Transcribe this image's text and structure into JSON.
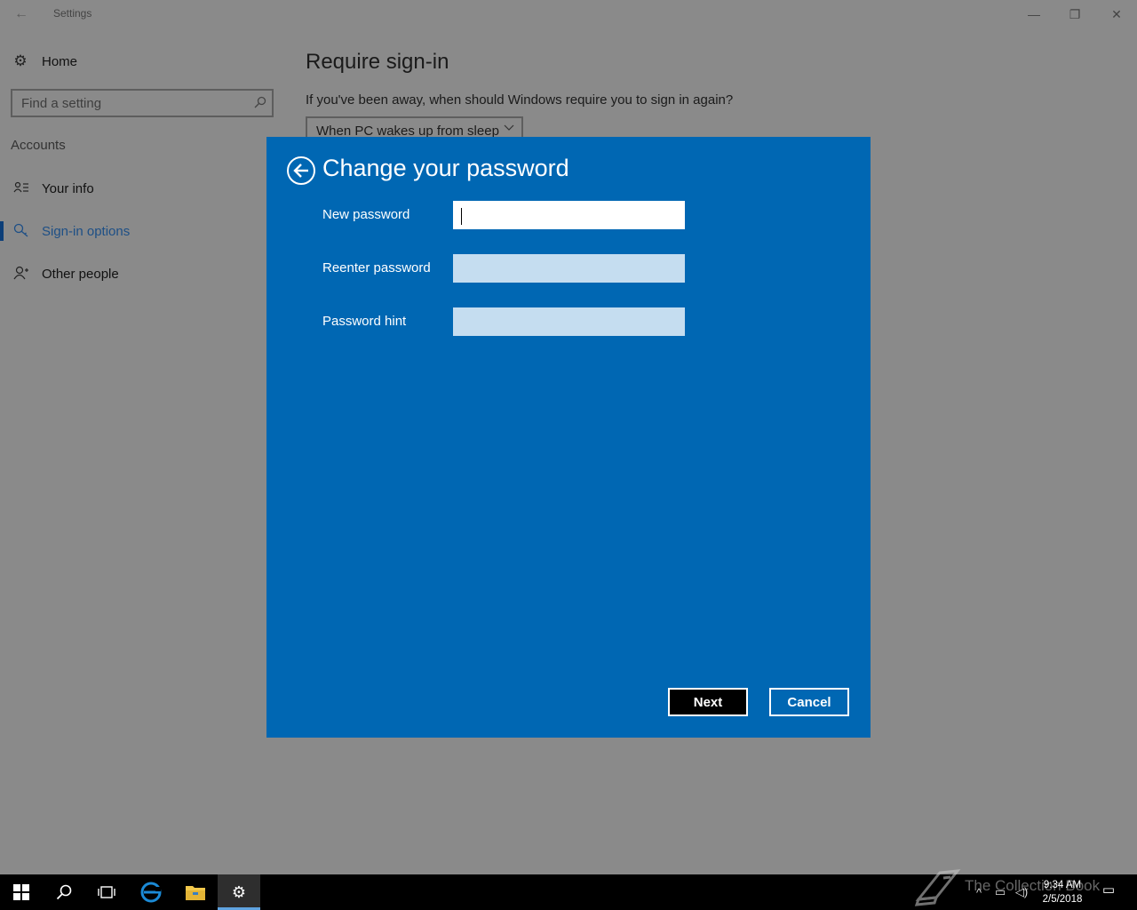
{
  "window": {
    "title": "Settings",
    "back_icon": "back-arrow-icon",
    "controls": {
      "minimize": "—",
      "maximize": "❐",
      "close": "✕"
    }
  },
  "sidebar": {
    "home_label": "Home",
    "search_placeholder": "Find a setting",
    "section": "Accounts",
    "items": [
      {
        "label": "Your info",
        "icon": "person-card-icon"
      },
      {
        "label": "Sign-in options",
        "icon": "key-icon",
        "active": true
      },
      {
        "label": "Other people",
        "icon": "add-person-icon"
      }
    ]
  },
  "content": {
    "title": "Require sign-in",
    "description": "If you've been away, when should Windows require you to sign in again?",
    "dropdown_value": "When PC wakes up from sleep"
  },
  "dialog": {
    "title": "Change your password",
    "fields": [
      {
        "label": "New password",
        "value": ""
      },
      {
        "label": "Reenter password",
        "value": ""
      },
      {
        "label": "Password hint",
        "value": ""
      }
    ],
    "next_label": "Next",
    "cancel_label": "Cancel",
    "background": "#0067b3"
  },
  "taskbar": {
    "items": [
      "windows-start-icon",
      "search-icon",
      "task-view-icon",
      "edge-icon",
      "file-explorer-icon",
      "settings-gear-icon"
    ],
    "time": "9:34 AM",
    "date": "2/5/2018"
  },
  "watermark": {
    "text": "The Collection Book"
  }
}
